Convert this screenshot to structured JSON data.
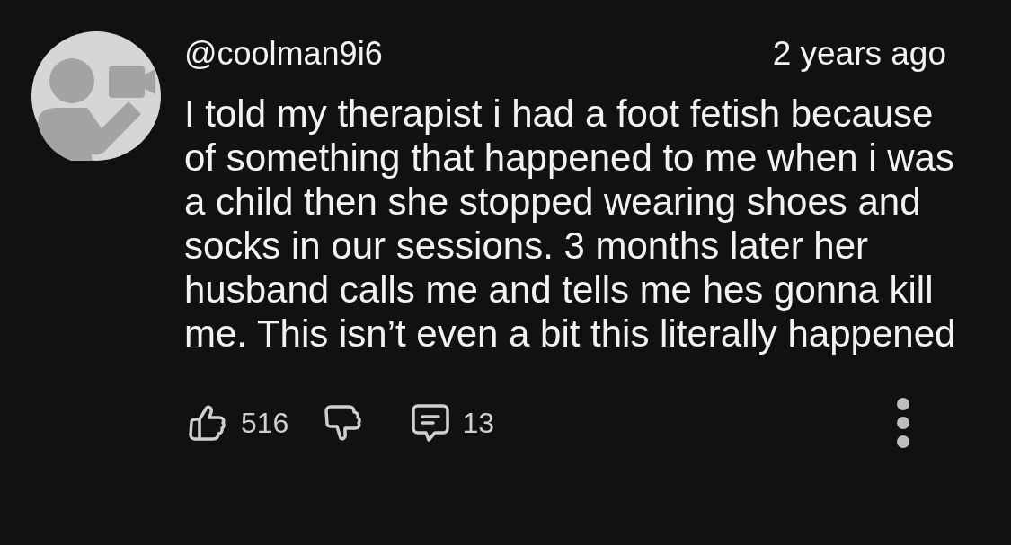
{
  "comment": {
    "author": "@coolman9i6",
    "time": "2 years ago",
    "text": "I told my therapist i had a foot fetish because of something that happened to me when i was a child then she stopped wearing shoes and socks in our sessions. 3 months later her husband calls me and tells me hes gonna kill me. This isn’t even a bit this literally happened",
    "likes": "516",
    "replies": "13"
  }
}
